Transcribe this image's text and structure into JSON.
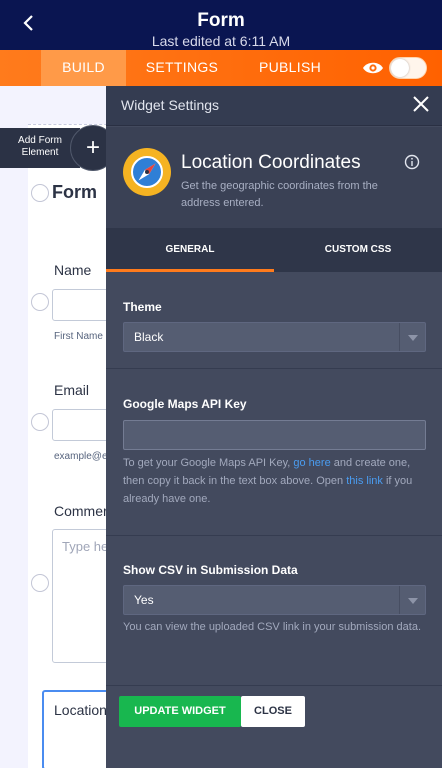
{
  "header": {
    "title": "Form",
    "subtitle": "Last edited at 6:11 AM"
  },
  "tabs": [
    {
      "label": "BUILD"
    },
    {
      "label": "SETTINGS"
    },
    {
      "label": "PUBLISH"
    }
  ],
  "form": {
    "title": "Form",
    "add_element_label": "Add Form Element",
    "fields": {
      "name_label": "Name",
      "name_sub": "First Name",
      "email_label": "Email",
      "email_sub": "example@e",
      "comments_label": "Commer",
      "comments_placeholder": "Type he",
      "location_label": "Location"
    }
  },
  "panel": {
    "title": "Widget Settings",
    "widget_name": "Location Coordinates",
    "widget_desc": "Get the geographic coordinates from the address entered.",
    "tab_general": "GENERAL",
    "tab_css": "CUSTOM CSS",
    "theme": {
      "label": "Theme",
      "value": "Black"
    },
    "api": {
      "label": "Google Maps API Key",
      "value": "",
      "help_1": "To get your Google Maps API Key, ",
      "help_link1": "go here",
      "help_2": " and create one, then copy it back in the text box above. Open ",
      "help_link2": "this link",
      "help_3": " if you already have one."
    },
    "csv": {
      "label": "Show CSV in Submission Data",
      "value": "Yes",
      "help": "You can view the uploaded CSV link in your submission data."
    },
    "update_button": "UPDATE WIDGET",
    "close_button": "CLOSE"
  },
  "colors": {
    "header_bg": "#0a1551",
    "tab_accent": "#ff6100",
    "panel_bg": "#434a5e",
    "update_green": "#18b74f",
    "link_blue": "#4a9cf0"
  }
}
